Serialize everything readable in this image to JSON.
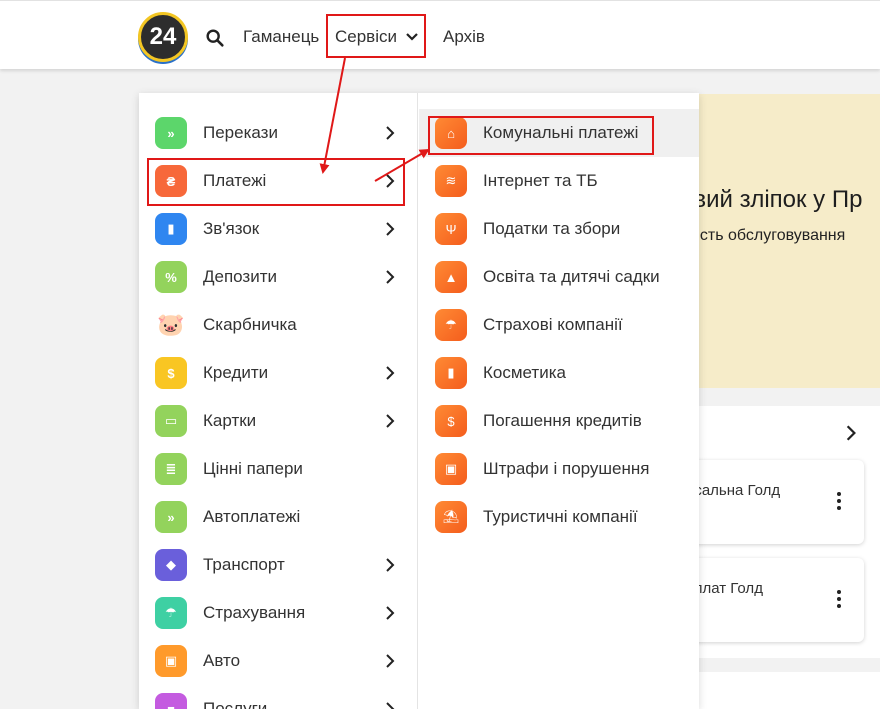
{
  "header": {
    "logo_text": "24",
    "search_icon": "search-icon",
    "nav": {
      "wallet": "Гаманець",
      "services": "Сервіси",
      "archive": "Архів"
    }
  },
  "background": {
    "banner_title": "овий зліпок у Пр",
    "banner_sub": "дкість обслуговування",
    "cards": [
      "рсальна Голд",
      "иплат Голд"
    ]
  },
  "menu": {
    "left": [
      {
        "label": "Перекази",
        "icon": "transfer-icon",
        "glyph": "»",
        "color": "#5cd66b",
        "arrow": true
      },
      {
        "label": "Платежі",
        "icon": "payments-icon",
        "glyph": "₴",
        "color": "#f7683a",
        "arrow": true
      },
      {
        "label": "Зв'язок",
        "icon": "signal-icon",
        "glyph": "▮",
        "color": "#2f86f0",
        "arrow": true
      },
      {
        "label": "Депозити",
        "icon": "percent-icon",
        "glyph": "%",
        "color": "#93d35c",
        "arrow": true
      },
      {
        "label": "Скарбничка",
        "icon": "piggy-bank-icon",
        "glyph": "🐷",
        "color": "#ffffff",
        "arrow": false
      },
      {
        "label": "Кредити",
        "icon": "money-bag-icon",
        "glyph": "$",
        "color": "#f9c623",
        "arrow": true
      },
      {
        "label": "Картки",
        "icon": "card-icon",
        "glyph": "▭",
        "color": "#93d35c",
        "arrow": true
      },
      {
        "label": "Цінні папери",
        "icon": "securities-icon",
        "glyph": "≣",
        "color": "#93d35c",
        "arrow": false
      },
      {
        "label": "Автоплатежі",
        "icon": "calendar-icon",
        "glyph": "»",
        "color": "#93d35c",
        "arrow": false
      },
      {
        "label": "Транспорт",
        "icon": "ticket-icon",
        "glyph": "◆",
        "color": "#6a5fdb",
        "arrow": true
      },
      {
        "label": "Страхування",
        "icon": "umbrella-icon",
        "glyph": "☂",
        "color": "#3ed0a3",
        "arrow": true
      },
      {
        "label": "Авто",
        "icon": "car-icon",
        "glyph": "▣",
        "color": "#ff9a2b",
        "arrow": true
      },
      {
        "label": "Послуги",
        "icon": "services-icon",
        "glyph": "■",
        "color": "#c45be0",
        "arrow": true
      }
    ],
    "right": [
      {
        "label": "Комунальні платежі",
        "icon": "home-icon",
        "glyph": "⌂"
      },
      {
        "label": "Інтернет та ТБ",
        "icon": "wifi-icon",
        "glyph": "≋"
      },
      {
        "label": "Податки та збори",
        "icon": "trident-icon",
        "glyph": "Ψ"
      },
      {
        "label": "Освіта та дитячі садки",
        "icon": "graduation-cap-icon",
        "glyph": "▲"
      },
      {
        "label": "Страхові компанії",
        "icon": "umbrella-icon",
        "glyph": "☂"
      },
      {
        "label": "Косметика",
        "icon": "cosmetics-icon",
        "glyph": "▮"
      },
      {
        "label": "Погашення кредитів",
        "icon": "money-bag-icon",
        "glyph": "$"
      },
      {
        "label": "Штрафи і порушення",
        "icon": "badge-icon",
        "glyph": "▣"
      },
      {
        "label": "Туристичні компанії",
        "icon": "beach-umbrella-icon",
        "glyph": "⛱"
      }
    ]
  },
  "colors": {
    "annotation": "#e01818",
    "submenu_icon": "#f7683a"
  }
}
